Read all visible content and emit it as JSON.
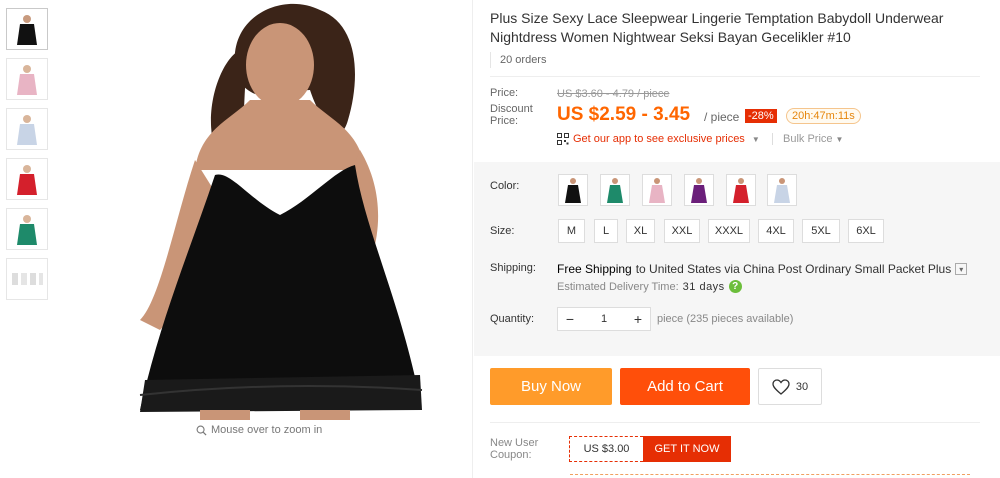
{
  "product": {
    "title": "Plus Size Sexy Lace Sleepwear Lingerie Temptation Babydoll Underwear Nightdress Women Nightwear Seksi Bayan Gecelikler #10",
    "orders": "20 orders"
  },
  "price": {
    "label": "Price:",
    "original": "US $3.60 - 4.79 / piece",
    "discount_label": "Discount Price:",
    "discount": "US $2.59 - 3.45",
    "unit": "/ piece",
    "off": "-28%",
    "countdown": "20h:47m:11s",
    "app_link": "Get our app to see exclusive prices",
    "bulk": "Bulk Price"
  },
  "options": {
    "color_label": "Color:",
    "colors": [
      "#111111",
      "#1e8a6a",
      "#e8b4c4",
      "#6b1f7a",
      "#d4202c",
      "#c8d4e6"
    ],
    "size_label": "Size:",
    "sizes": [
      "M",
      "L",
      "XL",
      "XXL",
      "XXXL",
      "4XL",
      "5XL",
      "6XL"
    ],
    "shipping_label": "Shipping:",
    "shipping_free": "Free Shipping",
    "shipping_rest": "to United States via China Post Ordinary Small Packet Plus",
    "delivery_label": "Estimated Delivery Time:",
    "delivery_days": "31 days",
    "quantity_label": "Quantity:",
    "quantity_value": "1",
    "quantity_note": "piece (235 pieces available)"
  },
  "actions": {
    "buy_now": "Buy Now",
    "add_to_cart": "Add to Cart",
    "wish_count": "30"
  },
  "coupon": {
    "label": "New User Coupon:",
    "amount": "US $3.00",
    "button": "GET IT NOW"
  },
  "gallery": {
    "zoom_hint": "Mouse over to zoom in",
    "thumb_colors": [
      "#111111",
      "#e8b4c4",
      "#c8d4e6",
      "#d4202c",
      "#1e8a6a",
      "#dddddd"
    ]
  },
  "colors": {
    "accent": "#ff4f0a",
    "buy": "#ff9b2a",
    "badge": "#e62e04"
  }
}
